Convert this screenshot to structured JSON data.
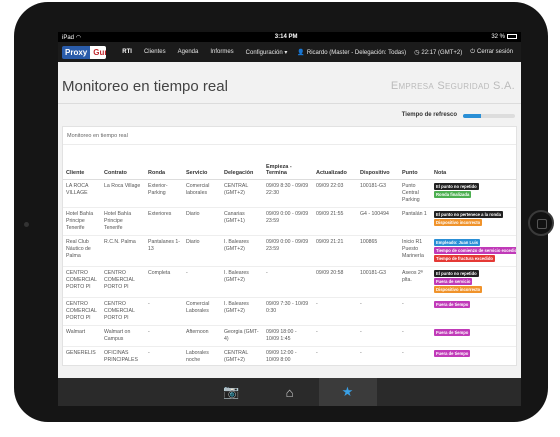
{
  "statusbar": {
    "device": "iPad",
    "wifi": "wifi-icon",
    "time": "3:14 PM",
    "battery": "32 %"
  },
  "nav": {
    "logo_part1": "Proxy",
    "logo_part2": "Gun",
    "items": [
      {
        "label": "RTI",
        "active": true
      },
      {
        "label": "Clientes",
        "active": false
      },
      {
        "label": "Agenda",
        "active": false
      },
      {
        "label": "Informes",
        "active": false
      },
      {
        "label": "Configuración ▾",
        "active": false
      }
    ],
    "user": "Ricardo (Master - Delegación: Todas)",
    "clock": "22:17 (GMT+2)",
    "logout": "Cerrar sesión"
  },
  "header": {
    "title": "Monitoreo en tiempo real",
    "company": "Empresa Seguridad S.A."
  },
  "refresh": {
    "label": "Tiempo de refresco",
    "progress": 0.35
  },
  "panel": {
    "title": "Monitoreo en tiempo real",
    "columns": [
      "Cliente",
      "Contrato",
      "Ronda",
      "Servicio",
      "Delegación",
      "Empieza - Termina",
      "Actualizado",
      "Dispositivo",
      "Punto",
      "Nota"
    ],
    "rows": [
      {
        "cells": [
          "LA ROCA VILLAGE",
          "La Roca Village",
          "Exterior-Parking",
          "Comercial laborales",
          "CENTRAL (GMT+2)",
          "09/09 8:30 - 09/09 22:30",
          "09/09 22:03",
          "100181-G3",
          "Punto Central Parking"
        ],
        "notes": [
          {
            "text": "El punto no repetido",
            "color": "#222222"
          },
          {
            "text": "Ronda finalizada",
            "color": "#4caf50"
          }
        ]
      },
      {
        "cells": [
          "Hotel Bahía Principe Tenerife",
          "Hotel Bahía Principe Tenerife",
          "Exteriores",
          "Diario",
          "Canarias (GMT+1)",
          "09/09 0:00 - 09/09 23:59",
          "09/09 21:55",
          "G4 - 100494",
          "Pantalán 1"
        ],
        "notes": [
          {
            "text": "El punto no pertenece a la ronda",
            "color": "#222222"
          },
          {
            "text": "Dispositivo incorrecto",
            "color": "#f0932b"
          }
        ]
      },
      {
        "cells": [
          "Real Club Náutico de Palma",
          "R.C.N. Palma",
          "Pantalanes 1-13",
          "Diario",
          "I. Baleares (GMT+2)",
          "09/09 0:00 - 09/09 23:59",
          "09/09 21:21",
          "100865",
          "Inicio R1 Puesto Marinería"
        ],
        "notes": [
          {
            "text": "Empleado: Juan Luis",
            "color": "#2a8fd6"
          },
          {
            "text": "Tiempo de comienzo de servicio excedido",
            "color": "#c03ab8"
          },
          {
            "text": "Tiempo de fractura excedido",
            "color": "#e53935"
          }
        ]
      },
      {
        "cells": [
          "CENTRO COMERCIAL PORTO PI",
          "CENTRO COMERCIAL PORTO PI",
          "Completa",
          "-",
          "I. Baleares (GMT+2)",
          "-",
          "09/09 20:58",
          "100181-G3",
          "Aseos 2ª plta."
        ],
        "notes": [
          {
            "text": "El punto no repetido",
            "color": "#222222"
          },
          {
            "text": "Fuera de servicio",
            "color": "#c03ab8"
          },
          {
            "text": "Dispositivo incorrecto",
            "color": "#f0932b"
          }
        ]
      },
      {
        "cells": [
          "CENTRO COMERCIAL PORTO PI",
          "CENTRO COMERCIAL PORTO PI",
          "-",
          "Comercial Laborales",
          "I. Baleares (GMT+2)",
          "09/09 7:30 - 10/09 0:30",
          "-",
          "-",
          "-"
        ],
        "notes": [
          {
            "text": "Fuera de tiempo",
            "color": "#c03ab8"
          }
        ]
      },
      {
        "cells": [
          "Walmart",
          "Walmart on Campus",
          "-",
          "Afternoon",
          "Georgia (GMT-4)",
          "09/09 18:00 - 10/09 1:45",
          "-",
          "-",
          "-"
        ],
        "notes": [
          {
            "text": "Fuera de tiempo",
            "color": "#c03ab8"
          }
        ]
      },
      {
        "cells": [
          "GENERELIS",
          "OFICINAS PRINCIPALES",
          "-",
          "Laborales noche",
          "CENTRAL (GMT+2)",
          "09/09 12:00 - 10/09 8:00",
          "-",
          "-",
          "-"
        ],
        "notes": [
          {
            "text": "Fuera de tiempo",
            "color": "#c03ab8"
          }
        ]
      }
    ]
  },
  "tabbar": {
    "tabs": [
      {
        "icon": "camera-icon",
        "glyph": "📷",
        "active": false
      },
      {
        "icon": "home-icon",
        "glyph": "⌂",
        "active": false
      },
      {
        "icon": "star-icon",
        "glyph": "★",
        "active": true
      }
    ]
  },
  "colors": {
    "accent": "#2a8fd6",
    "active_star": "#39a0e6"
  }
}
